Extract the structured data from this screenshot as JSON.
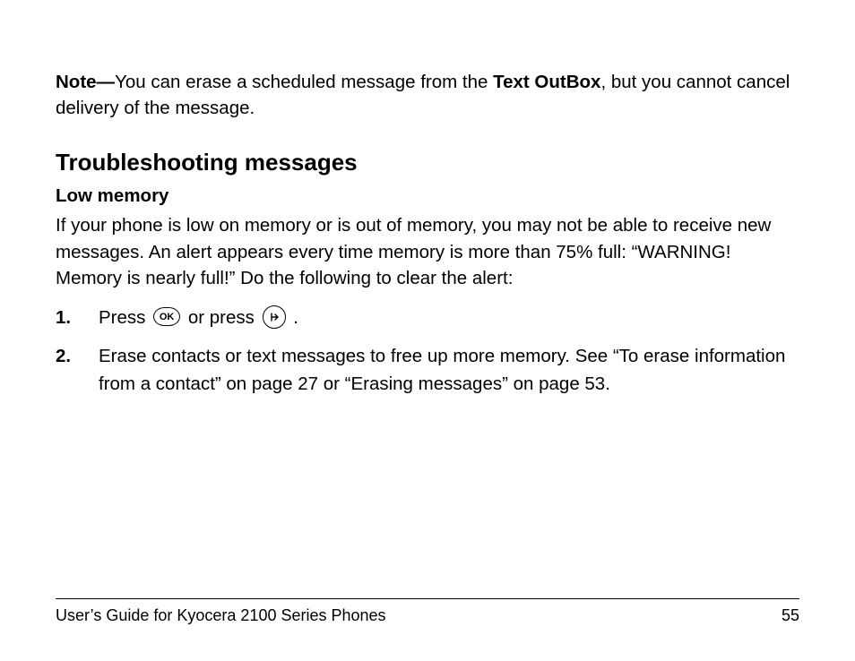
{
  "note": {
    "label": "Note—",
    "text_a": "You can erase a scheduled message from the ",
    "bold_inline": "Text OutBox",
    "text_b": ", but you cannot cancel delivery of the message."
  },
  "section_heading": "Troubleshooting messages",
  "sub_heading": "Low memory",
  "intro": "If your phone is low on memory or is out of memory, you may not be able to receive new messages. An alert appears every time memory is more than 75% full: “WARNING! Memory is nearly full!” Do the following to clear the alert:",
  "steps": [
    {
      "num": "1.",
      "pre": "Press ",
      "icon1": "ok-button-icon",
      "icon1_label": "OK",
      "mid": " or press  ",
      "icon2": "back-button-icon",
      "post": " ."
    },
    {
      "num": "2.",
      "text": "Erase contacts or text messages to free up more memory. See “To erase information from a contact” on page 27 or “Erasing messages” on page 53."
    }
  ],
  "footer": {
    "left": "User’s Guide for Kyocera 2100 Series Phones",
    "right": "55"
  }
}
